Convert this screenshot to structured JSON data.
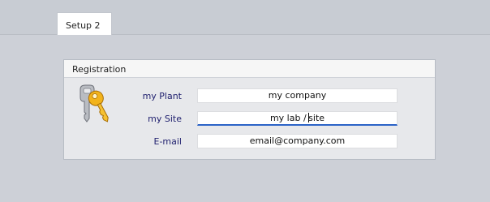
{
  "tabs": [
    {
      "label": "Setup 2",
      "active": true
    }
  ],
  "registration": {
    "title": "Registration",
    "icon": "keys-icon",
    "fields": [
      {
        "label": "my Plant",
        "value": "my company",
        "focused": false
      },
      {
        "label": "my Site",
        "value_before_caret": "my lab / ",
        "value_after_caret": "site",
        "focused": true
      },
      {
        "label": "E-mail",
        "value": "email@company.com",
        "focused": false
      }
    ]
  },
  "colors": {
    "accent": "#2b63c7",
    "label_text": "#1f1f6e",
    "panel_bg": "#cdd0d7"
  }
}
